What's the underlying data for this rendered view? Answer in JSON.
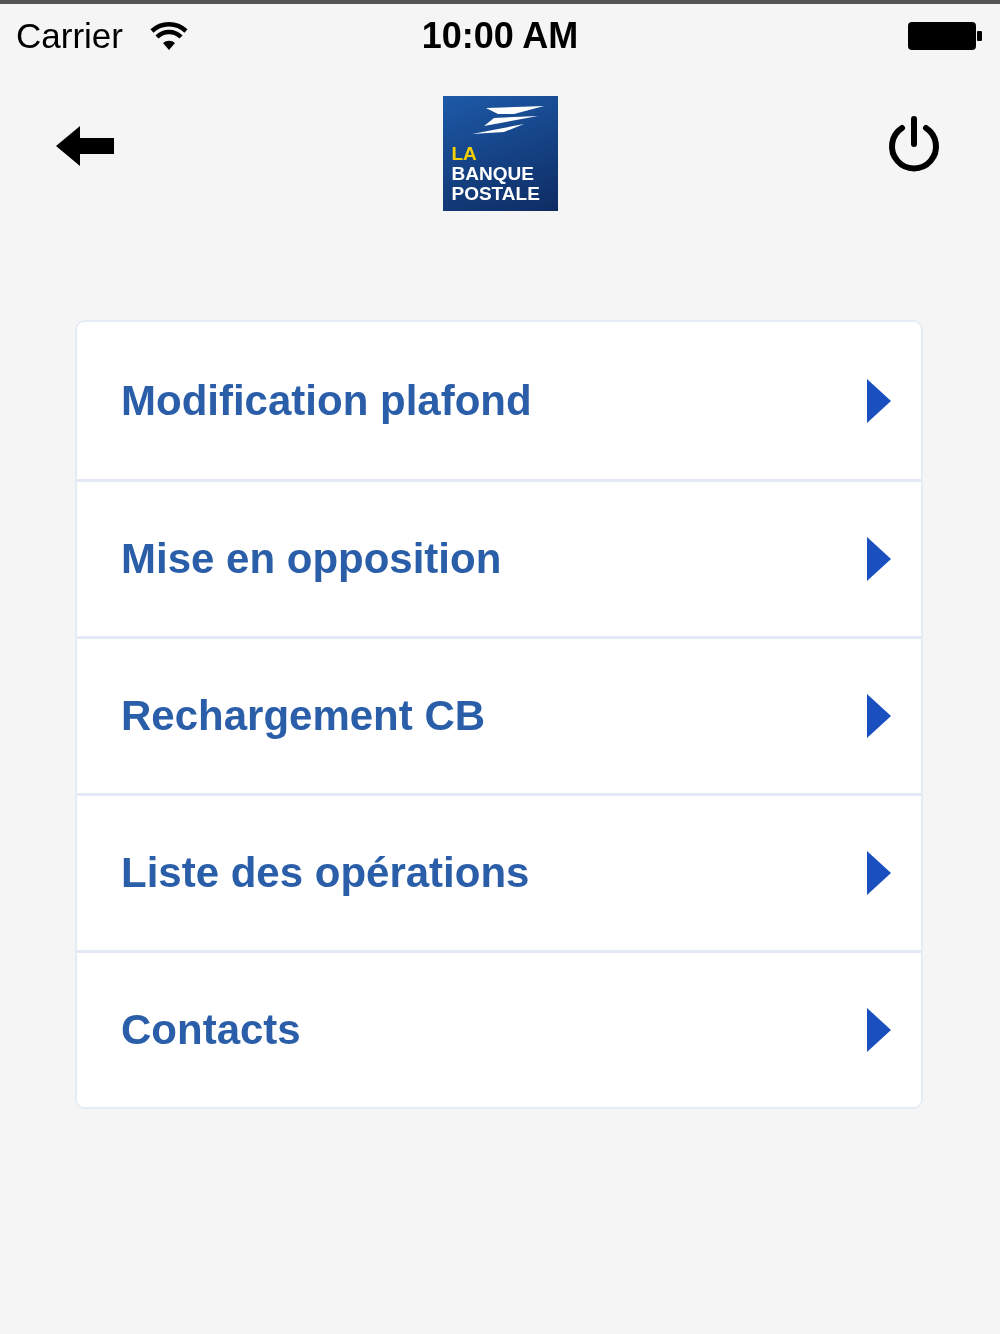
{
  "status_bar": {
    "carrier": "Carrier",
    "time": "10:00 AM"
  },
  "logo": {
    "lines": [
      {
        "text": "LA",
        "kind": "accent"
      },
      {
        "text": "BANQUE",
        "kind": "plain"
      },
      {
        "text": "POSTALE",
        "kind": "plain"
      }
    ]
  },
  "menu": [
    {
      "label": "Modification plafond"
    },
    {
      "label": "Mise en opposition"
    },
    {
      "label": "Rechargement CB"
    },
    {
      "label": "Liste des opérations"
    },
    {
      "label": "Contacts"
    }
  ]
}
